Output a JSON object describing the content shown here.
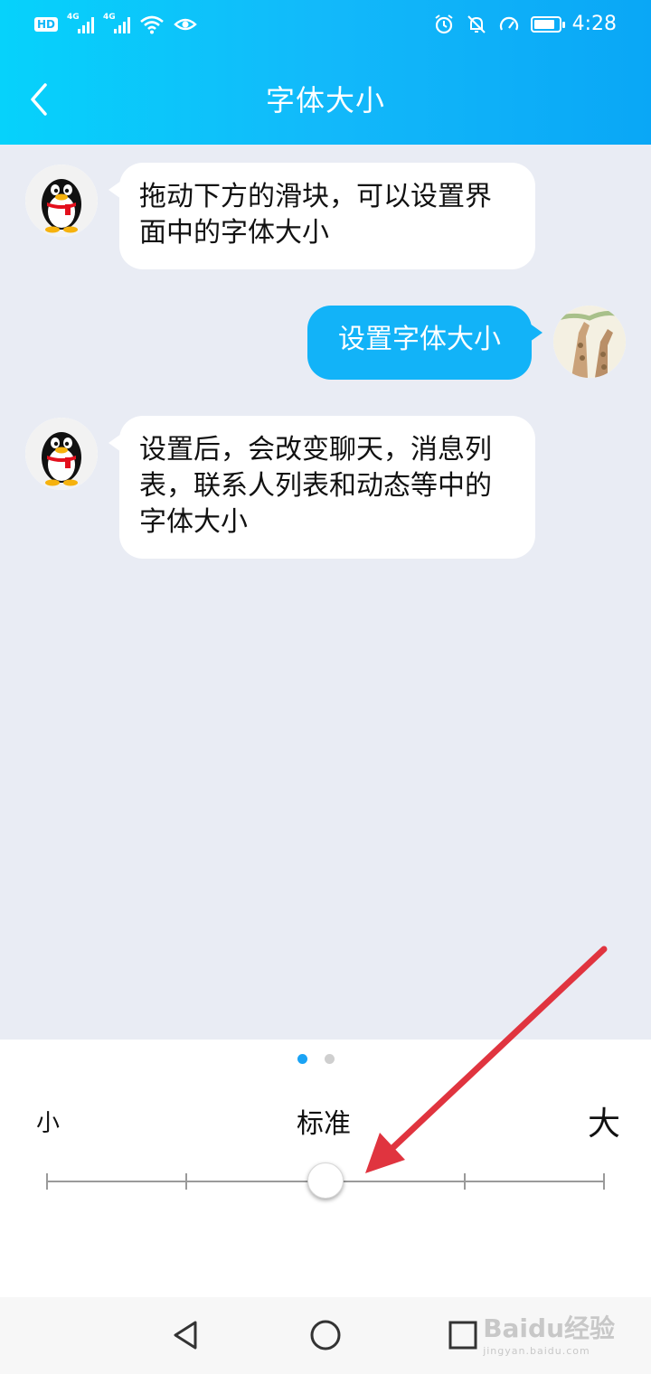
{
  "status_bar": {
    "hd_label": "HD",
    "network_1": "4G",
    "network_2": "4G",
    "time": "4:28",
    "battery_level": 0.85,
    "icons": [
      "wifi-icon",
      "eye-icon",
      "alarm-icon",
      "mute-icon",
      "speed-icon",
      "battery-icon"
    ]
  },
  "header": {
    "title": "字体大小",
    "back_icon": "chevron-left-icon"
  },
  "chat": {
    "messages": [
      {
        "from": "qq",
        "text": "拖动下方的滑块，可以设置界面中的字体大小"
      },
      {
        "from": "me",
        "text": "设置字体大小"
      },
      {
        "from": "qq",
        "text": "设置后，会改变聊天，消息列表，联系人列表和动态等中的字体大小"
      }
    ]
  },
  "slider": {
    "label_small": "小",
    "label_standard": "标准",
    "label_large": "大",
    "steps": 5,
    "selected_step": 2,
    "page_index": 0,
    "page_count": 2
  },
  "nav": {
    "back_icon": "triangle-back-icon",
    "home_icon": "circle-home-icon",
    "recents_icon": "square-recents-icon"
  },
  "watermark": {
    "brand": "Baidu经验",
    "url": "jingyan.baidu.com"
  },
  "colors": {
    "header": "#12b9fa",
    "bubble_mine": "#12b3f8",
    "background": "#e9ecf4",
    "arrow": "#e0343f",
    "page_dot_active": "#1aa3f5"
  }
}
